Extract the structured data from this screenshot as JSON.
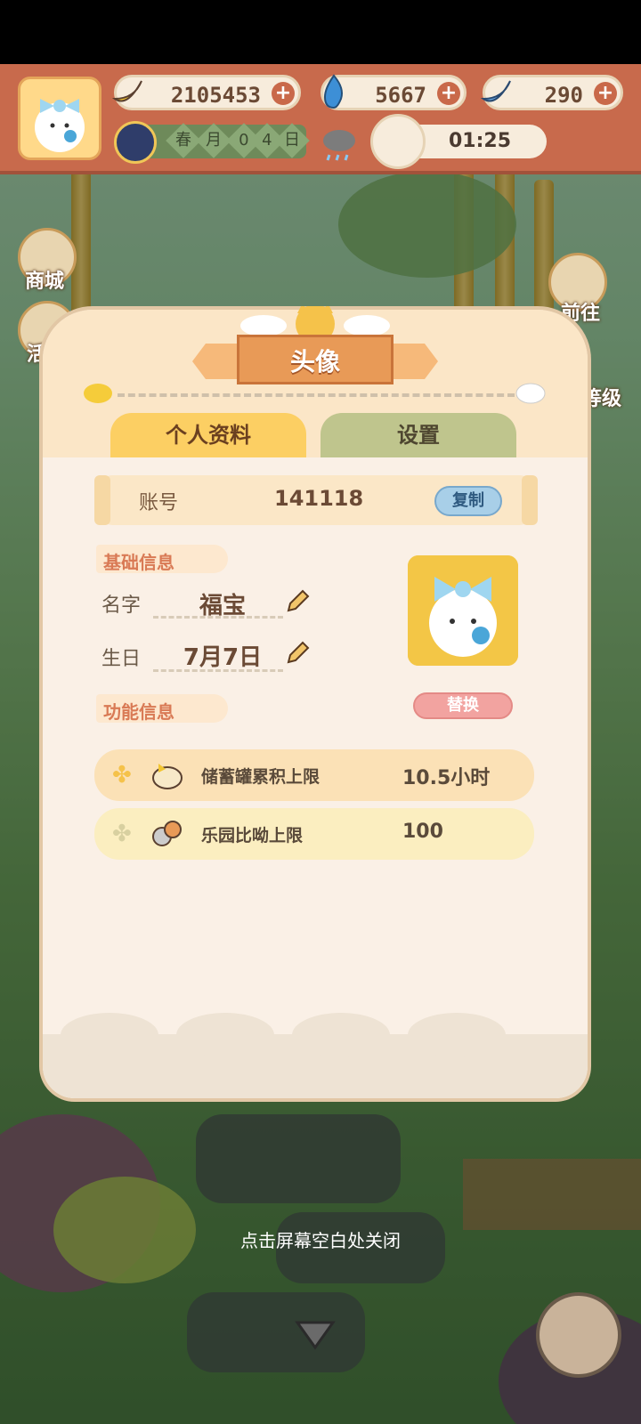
{
  "top_bar": {
    "bananas": "2105453",
    "flames": "5667",
    "gems": "290",
    "date_chars": [
      "春",
      "月",
      "0",
      "4",
      "日"
    ],
    "timer": "01:25"
  },
  "side_menu": {
    "shop_label": "商城",
    "event_label": "活",
    "goto_label": "前往",
    "level_label": "等级"
  },
  "modal": {
    "title": "头像",
    "tabs": [
      {
        "label": "个人资料",
        "active": true
      },
      {
        "label": "设置",
        "active": false
      }
    ],
    "account": {
      "label": "账号",
      "value": "141118",
      "copy_label": "复制"
    },
    "basic_section": "基础信息",
    "name_label": "名字",
    "name_value": "福宝",
    "birthday_label": "生日",
    "birthday_value": "7月7日",
    "replace_label": "替换",
    "function_section": "功能信息",
    "info_rows": [
      {
        "label": "储蓄罐累积上限",
        "value": "10.5小时",
        "icon": "piggy-bank-icon"
      },
      {
        "label": "乐园比呦上限",
        "value": "100",
        "icon": "creature-group-icon"
      }
    ]
  },
  "close_hint": "点击屏幕空白处关闭",
  "colors": {
    "tab_active": "#fccf63",
    "tab_inactive": "#bfc58d",
    "accent": "#e89a57",
    "top_bar": "#c86a4c"
  }
}
